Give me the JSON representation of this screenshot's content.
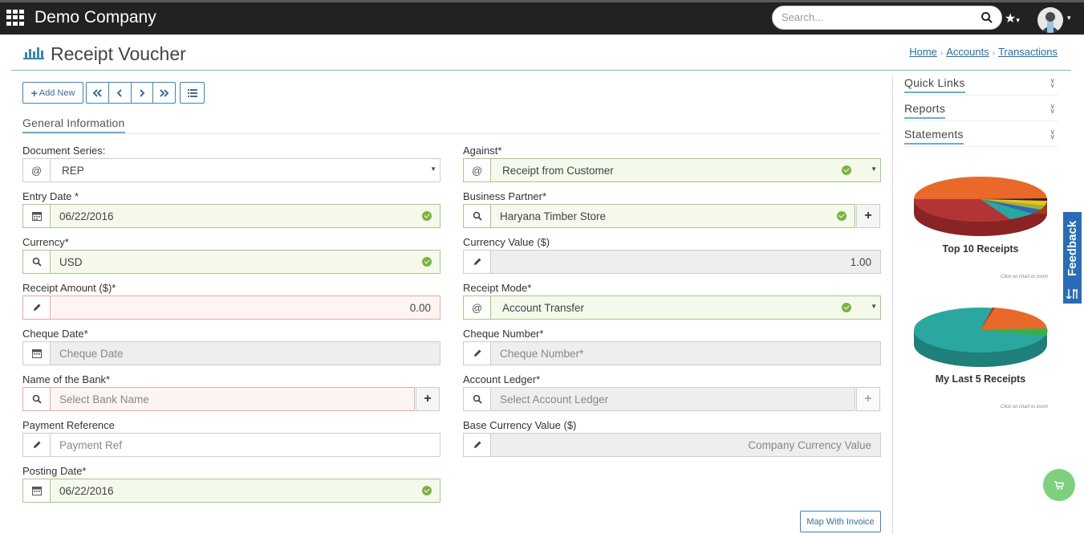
{
  "app": {
    "company": "Demo Company"
  },
  "search": {
    "placeholder": "Search..."
  },
  "page": {
    "title": "Receipt Voucher"
  },
  "breadcrumb": [
    "Home",
    "Accounts",
    "Transactions"
  ],
  "toolbar": {
    "add_new": "Add New"
  },
  "section": {
    "title": "General Information"
  },
  "fields": {
    "document_series": {
      "label": "Document Series:",
      "value": "REP"
    },
    "against": {
      "label": "Against*",
      "value": "Receipt from Customer"
    },
    "entry_date": {
      "label": "Entry Date *",
      "value": "06/22/2016"
    },
    "business_partner": {
      "label": "Business Partner*",
      "value": "Haryana Timber Store"
    },
    "currency": {
      "label": "Currency*",
      "value": "USD"
    },
    "currency_value": {
      "label": "Currency Value ($)",
      "value": "1.00"
    },
    "receipt_amount": {
      "label": "Receipt Amount ($)*",
      "value": "0.00"
    },
    "receipt_mode": {
      "label": "Receipt Mode*",
      "value": "Account Transfer"
    },
    "cheque_date": {
      "label": "Cheque Date*",
      "placeholder": "Cheque Date"
    },
    "cheque_number": {
      "label": "Cheque Number*",
      "placeholder": "Cheque Number*"
    },
    "bank_name": {
      "label": "Name of the Bank*",
      "placeholder": "Select Bank Name"
    },
    "account_ledger": {
      "label": "Account Ledger*",
      "placeholder": "Select Account Ledger"
    },
    "payment_reference": {
      "label": "Payment Reference",
      "placeholder": "Payment Ref"
    },
    "base_currency_value": {
      "label": "Base Currency Value ($)",
      "placeholder": "Company Currency Value"
    },
    "posting_date": {
      "label": "Posting Date*",
      "value": "06/22/2016"
    }
  },
  "map_button": "Map With Invoice",
  "sidebar": {
    "accordions": [
      "Quick Links",
      "Reports",
      "Statements"
    ],
    "charts": [
      {
        "title": "Top 10 Receipts",
        "note": "Click on chart to zoom"
      },
      {
        "title": "My Last 5 Receipts",
        "note": "Click on chart to zoom"
      }
    ]
  },
  "feedback": "Feedback",
  "colors": {
    "topbar": "#222222",
    "accent": "#3a86b4",
    "success": "#7cb342",
    "feedback": "#2b6cb6"
  }
}
